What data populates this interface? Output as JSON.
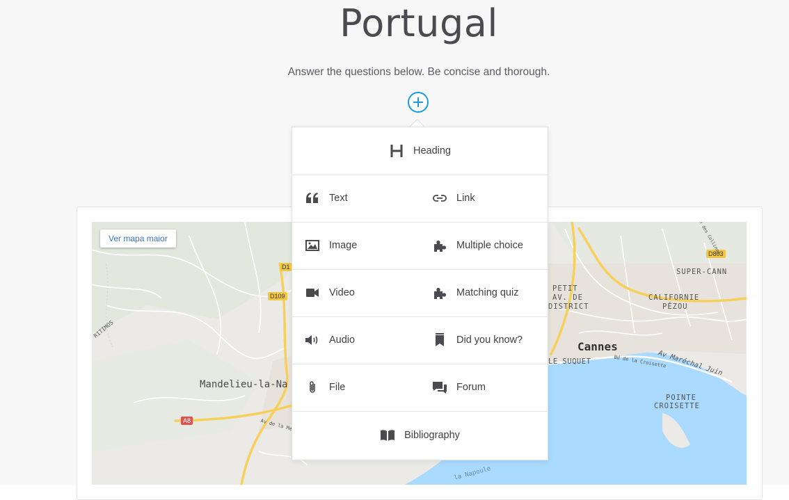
{
  "page": {
    "title": "Portugal",
    "subtitle": "Answer the questions below. Be concise and thorough."
  },
  "map": {
    "button_label": "Ver mapa maior",
    "labels": {
      "mandelieu": "Mandelieu-la-Na",
      "cannes": "Cannes",
      "le_suquet": "LE SUQUET",
      "petit1": "PETIT",
      "petit2": "AV. DE",
      "petit3": "DISTRICT",
      "californie1": "CALIFORNIE",
      "californie2": "PÉZOU",
      "super_cann": "SUPER-CANN",
      "pointe1": "POINTE",
      "pointe2": "CROISETTE",
      "av_marechal": "Av Maréchal Juin",
      "bd_croisette": "Bd de la Croisette",
      "av_de_la_me": "Av de la Me",
      "la_napoule": "la Napoule",
      "ritimos": "RITIMOS",
      "collines": "man des Collines"
    },
    "road_tags": {
      "d1": "D1",
      "d109": "D109",
      "a8": "A8",
      "d803": "D803"
    }
  },
  "menu": {
    "heading": "Heading",
    "text": "Text",
    "link": "Link",
    "image": "Image",
    "multiple_choice": "Multiple choice",
    "video": "Video",
    "matching_quiz": "Matching quiz",
    "audio": "Audio",
    "did_you_know": "Did you know?",
    "file": "File",
    "forum": "Forum",
    "bibliography": "Bibliography"
  },
  "icons": {
    "add": "plus-circle-icon",
    "heading": "heading-icon",
    "text": "quote-icon",
    "link": "link-icon",
    "image": "image-icon",
    "multiple_choice": "puzzle-icon",
    "video": "video-camera-icon",
    "matching_quiz": "puzzle-icon",
    "audio": "speaker-icon",
    "did_you_know": "bookmark-icon",
    "file": "paperclip-icon",
    "forum": "chat-bubbles-icon",
    "bibliography": "open-book-icon"
  },
  "colors": {
    "accent": "#1a9ae0",
    "title": "#4b4b4f",
    "water": "#aadaff",
    "road_major": "#f7cf5b"
  }
}
